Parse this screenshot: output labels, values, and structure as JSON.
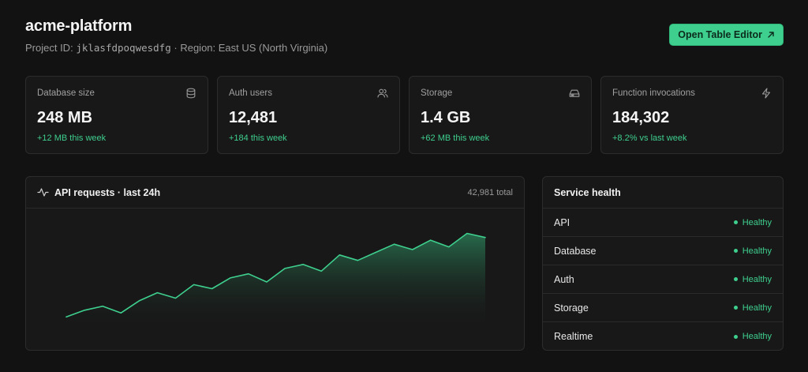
{
  "project": {
    "name": "acme-platform",
    "id_label": "Project ID:",
    "id": "jklasfdpoqwesdfg",
    "separator": "·",
    "region_label": "Region:",
    "region": "East US (North Virginia)"
  },
  "actions": {
    "open_table_editor": "Open Table Editor",
    "open_table_editor_icon": "arrow-up-right-icon"
  },
  "stats": [
    {
      "label": "Database size",
      "value": "248 MB",
      "delta": "+12 MB this week",
      "icon": "database-icon"
    },
    {
      "label": "Auth users",
      "value": "12,481",
      "delta": "+184 this week",
      "icon": "users-icon"
    },
    {
      "label": "Storage",
      "value": "1.4 GB",
      "delta": "+62 MB this week",
      "icon": "hard-drive-icon"
    },
    {
      "label": "Function invocations",
      "value": "184,302",
      "delta": "+8.2% vs last week",
      "icon": "zap-icon"
    }
  ],
  "api": {
    "title": "API requests · last 24h",
    "total": "42,981 total",
    "icon": "activity-icon"
  },
  "chart_data": {
    "type": "area",
    "title": "API requests · last 24h",
    "x": [
      1,
      2,
      3,
      4,
      5,
      6,
      7,
      8,
      9,
      10,
      11,
      12,
      13,
      14,
      15,
      16,
      17,
      18,
      19,
      20,
      21,
      22,
      23,
      24
    ],
    "values": [
      8,
      13,
      16,
      11,
      20,
      26,
      22,
      32,
      29,
      37,
      40,
      34,
      44,
      47,
      42,
      54,
      50,
      56,
      62,
      58,
      65,
      60,
      70,
      67
    ],
    "ylim": [
      0,
      75
    ],
    "grid": false,
    "colors": {
      "line": "#3ecf8e",
      "fill_top": "#2a7a55",
      "fill_bottom": "#181818"
    }
  },
  "health": {
    "title": "Service health",
    "services": [
      {
        "name": "API",
        "status": "Healthy"
      },
      {
        "name": "Database",
        "status": "Healthy"
      },
      {
        "name": "Auth",
        "status": "Healthy"
      },
      {
        "name": "Storage",
        "status": "Healthy"
      },
      {
        "name": "Realtime",
        "status": "Healthy"
      }
    ]
  },
  "theme": {
    "accent": "#3ecf8e",
    "background": "#121212",
    "panel": "#181818",
    "border": "#2c2c2c"
  }
}
